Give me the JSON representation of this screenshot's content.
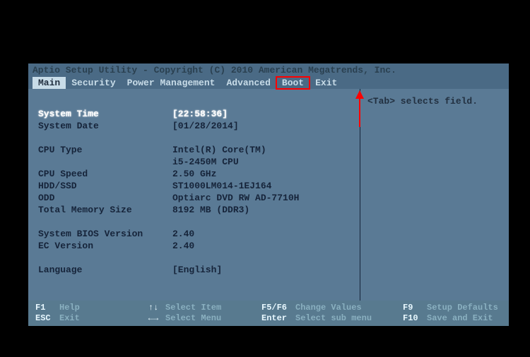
{
  "header": "Aptio Setup Utility - Copyright (C) 2010 American Megatrends, Inc.",
  "tabs": {
    "main": "Main",
    "security": "Security",
    "power": "Power Management",
    "advanced": "Advanced",
    "boot": "Boot",
    "exit": "Exit"
  },
  "help_text": "<Tab> selects field.",
  "info": {
    "system_time": {
      "label": "System Time",
      "value": "[22:58:36]"
    },
    "system_date": {
      "label": "System Date",
      "value": "[01/28/2014]"
    },
    "cpu_type": {
      "label": "CPU Type",
      "value1": "Intel(R) Core(TM)",
      "value2": "i5-2450M CPU"
    },
    "cpu_speed": {
      "label": "CPU Speed",
      "value": "2.50 GHz"
    },
    "hdd_ssd": {
      "label": "HDD/SSD",
      "value": "ST1000LM014-1EJ164"
    },
    "odd": {
      "label": "ODD",
      "value": "Optiarc DVD RW AD-7710H"
    },
    "total_memory": {
      "label": "Total Memory Size",
      "value": "8192 MB (DDR3)"
    },
    "bios_version": {
      "label": "System BIOS Version",
      "value": "2.40"
    },
    "ec_version": {
      "label": "EC Version",
      "value": "2.40"
    },
    "language": {
      "label": "Language",
      "value": "[English]"
    }
  },
  "footer": {
    "f1": {
      "key": "F1",
      "action": "Help"
    },
    "esc": {
      "key": "ESC",
      "action": "Exit"
    },
    "updown": {
      "key": "↑↓",
      "action": "Select Item"
    },
    "leftright": {
      "key": "←→",
      "action": "Select Menu"
    },
    "f5f6": {
      "key": "F5/F6",
      "action": "Change Values"
    },
    "enter": {
      "key": "Enter",
      "action": "Select sub menu"
    },
    "f9": {
      "key": "F9",
      "action": "Setup Defaults"
    },
    "f10": {
      "key": "F10",
      "action": "Save and Exit"
    }
  }
}
